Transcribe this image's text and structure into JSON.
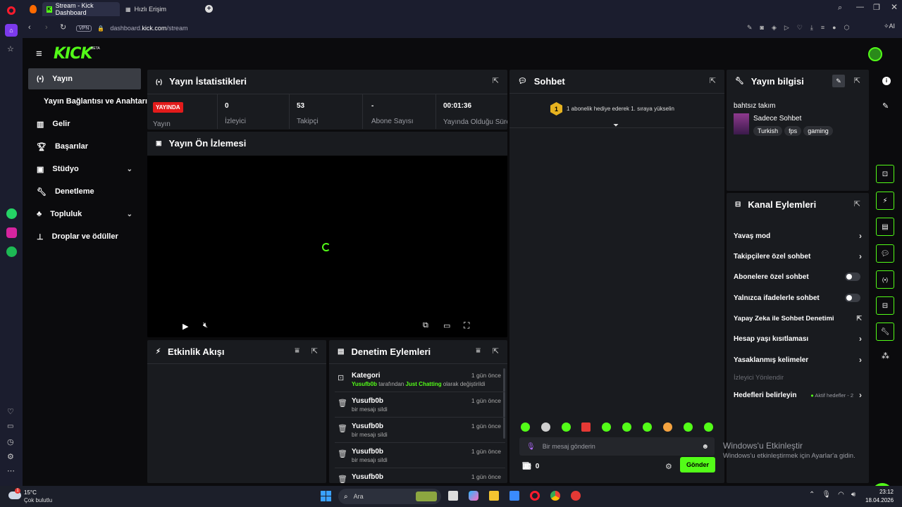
{
  "browser": {
    "tabs": [
      {
        "label": "Stream - Kick Dashboard",
        "active": true
      },
      {
        "label": "Hızlı Erişim",
        "active": false
      }
    ],
    "vpn_label": "VPN",
    "url_prefix": "dashboard.",
    "url_domain": "kick.com",
    "url_path": "/stream",
    "ai_label": "AI"
  },
  "app": {
    "logo": "KICK",
    "logo_badge": "BETA",
    "accent": "#53fc18"
  },
  "sidebar": {
    "items": [
      {
        "label": "Yayın",
        "icon": "broadcast-icon",
        "active": true
      },
      {
        "label": "Yayın Bağlantısı ve Anahtarı",
        "icon": "",
        "active": false
      },
      {
        "label": "Gelir",
        "icon": "chart-icon",
        "active": false
      },
      {
        "label": "Başarılar",
        "icon": "trophy-icon",
        "active": false
      },
      {
        "label": "Stüdyo",
        "icon": "studio-icon",
        "active": false,
        "expandable": true
      },
      {
        "label": "Denetleme",
        "icon": "wrench-icon",
        "active": false
      },
      {
        "label": "Topluluk",
        "icon": "community-icon",
        "active": false,
        "expandable": true
      },
      {
        "label": "Droplar ve ödüller",
        "icon": "drops-icon",
        "active": false
      }
    ]
  },
  "stats": {
    "title": "Yayın İstatistikleri",
    "live_badge": "YAYINDA",
    "cells": [
      {
        "value": "",
        "label": "Yayın"
      },
      {
        "value": "0",
        "label": "İzleyici"
      },
      {
        "value": "53",
        "label": "Takipçi"
      },
      {
        "value": "-",
        "label": "Abone Sayısı"
      },
      {
        "value": "00:01:36",
        "label": "Yayında Olduğu Süre"
      }
    ]
  },
  "preview": {
    "title": "Yayın Ön İzlemesi"
  },
  "activity": {
    "title": "Etkinlik Akışı"
  },
  "moderation": {
    "title": "Denetim Eylemleri",
    "rows": [
      {
        "title": "Kategori",
        "user": "Yusufb0b",
        "mid": " tarafından ",
        "highlight": "Just Chatting",
        "tail": " olarak değiştirildi",
        "time": "1 gün önce",
        "icon": "category-icon"
      },
      {
        "title": "Yusufb0b",
        "sub": "bir mesajı sildi",
        "time": "1 gün önce",
        "icon": "trash-icon"
      },
      {
        "title": "Yusufb0b",
        "sub": "bir mesajı sildi",
        "time": "1 gün önce",
        "icon": "trash-icon"
      },
      {
        "title": "Yusufb0b",
        "sub": "bir mesajı sildi",
        "time": "1 gün önce",
        "icon": "trash-icon"
      },
      {
        "title": "Yusufb0b",
        "sub": "",
        "time": "1 gün önce",
        "icon": "trash-icon"
      }
    ]
  },
  "chat": {
    "title": "Sohbet",
    "pinned": "1 abonelik hediye ederek 1. sıraya yükselin",
    "pinned_rank": "1",
    "input_placeholder": "Bir mesaj gönderin",
    "count": "0",
    "send_label": "Gönder"
  },
  "stream_info": {
    "title": "Yayın bilgisi",
    "stream_title": "bahtsız takım",
    "category": "Sadece Sohbet",
    "tags": [
      "Turkish",
      "fps",
      "gaming"
    ]
  },
  "channel_actions": {
    "title": "Kanal Eylemleri",
    "items": [
      {
        "label": "Yavaş mod",
        "control": "arrow"
      },
      {
        "label": "Takipçilere özel sohbet",
        "control": "arrow"
      },
      {
        "label": "Abonelere özel sohbet",
        "control": "toggle"
      },
      {
        "label": "Yalnızca ifadelerle sohbet",
        "control": "toggle"
      },
      {
        "label": "Yapay Zeka ile Sohbet Denetimi",
        "control": "external"
      },
      {
        "label": "Hesap yaşı kısıtlaması",
        "control": "arrow"
      },
      {
        "label": "Yasaklanmış kelimeler",
        "control": "arrow"
      }
    ],
    "section_label": "İzleyici Yönlendir",
    "goals_label": "Hedefleri belirleyin",
    "goals_status": "Aktif hedefler - 2"
  },
  "windows_watermark": {
    "title": "Windows'u Etkinleştir",
    "body": "Windows'u etkinleştirmek için Ayarlar'a gidin."
  },
  "taskbar": {
    "weather_temp": "15°C",
    "weather_desc": "Çok bulutlu",
    "weather_badge": "1",
    "search_placeholder": "Ara",
    "time": "23:12",
    "date": "18.04.2026"
  }
}
